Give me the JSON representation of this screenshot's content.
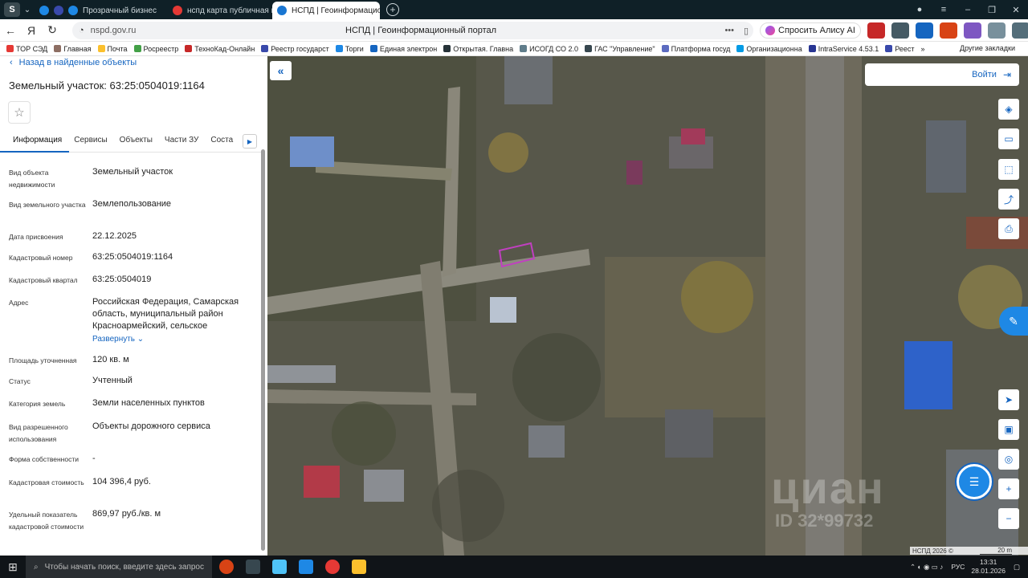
{
  "browser": {
    "tabs": [
      {
        "label": "Прозрачный бизнес",
        "favicon_color": "#1e88e5",
        "active": false
      },
      {
        "label": "нспд карта публичная кад",
        "favicon_color": "#e53935",
        "active": false
      },
      {
        "label": "НСПД | Геоинформацио",
        "favicon_color": "#1976d2",
        "active": true
      }
    ],
    "url_host": "nspd.gov.ru",
    "page_title": "НСПД | Геоинформационный портал",
    "alice_label": "Спросить Алису AI",
    "bookmarks": [
      {
        "label": "ТОР СЭД",
        "color": "#e53935"
      },
      {
        "label": "Главная",
        "color": "#8d6e63"
      },
      {
        "label": "Почта",
        "color": "#fbc02d"
      },
      {
        "label": "Росреестр",
        "color": "#43a047"
      },
      {
        "label": "ТехноКад-Онлайн",
        "color": "#c62828"
      },
      {
        "label": "Реестр государст",
        "color": "#3949ab"
      },
      {
        "label": "Торги",
        "color": "#1e88e5"
      },
      {
        "label": "Единая электрон",
        "color": "#1565c0"
      },
      {
        "label": "Открытая. Главна",
        "color": "#263238"
      },
      {
        "label": "ИСОГД СО 2.0",
        "color": "#607d8b"
      },
      {
        "label": "ГАС \"Управление\"",
        "color": "#37474f"
      },
      {
        "label": "Платформа госуд",
        "color": "#5c6bc0"
      },
      {
        "label": "Организационна",
        "color": "#039be5"
      },
      {
        "label": "IntraService 4.53.1",
        "color": "#283593"
      },
      {
        "label": "Реест",
        "color": "#3949ab"
      }
    ],
    "bookmarks_more": "»",
    "other_bookmarks": "Другие закладки"
  },
  "panel": {
    "back_label": "Назад в найденные объекты",
    "title": "Земельный участок: 63:25:0504019:1164",
    "tabs": [
      "Информация",
      "Сервисы",
      "Объекты",
      "Части ЗУ",
      "Соста"
    ],
    "active_tab": "Информация",
    "rows": [
      {
        "label": "Вид объекта недвижимости",
        "value": "Земельный участок"
      },
      {
        "label": "Вид земельного участка",
        "value": "Землепользование"
      },
      {
        "label": "Дата присвоения",
        "value": "22.12.2025"
      },
      {
        "label": "Кадастровый номер",
        "value": "63:25:0504019:1164"
      },
      {
        "label": "Кадастровый квартал",
        "value": "63:25:0504019"
      },
      {
        "label": "Адрес",
        "value": "Российская Федерация, Самарская область, муниципальный район Красноармейский, сельское"
      },
      {
        "label": "Площадь уточненная",
        "value": "120 кв. м"
      },
      {
        "label": "Статус",
        "value": "Учтенный"
      },
      {
        "label": "Категория земель",
        "value": "Земли населенных пунктов"
      },
      {
        "label": "Вид разрешенного использования",
        "value": "Объекты дорожного сервиса"
      },
      {
        "label": "Форма собственности",
        "value": "-"
      },
      {
        "label": "Кадастровая стоимость",
        "value": "104 396,4 руб."
      },
      {
        "label": "Удельный показатель кадастровой стоимости",
        "value": "869,97 руб./кв. м"
      }
    ],
    "expand_label": "Развернуть"
  },
  "map": {
    "login_label": "Войти",
    "watermark": "циан",
    "watermark_id": "ID 32*99732",
    "copyright": "НСПД 2026 ©",
    "scale_label": "20 m",
    "parcel_color": "#c040c0"
  },
  "taskbar": {
    "search_placeholder": "Чтобы начать поиск, введите здесь запрос",
    "lang": "РУС",
    "time": "13:31",
    "date": "28.01.2026"
  }
}
